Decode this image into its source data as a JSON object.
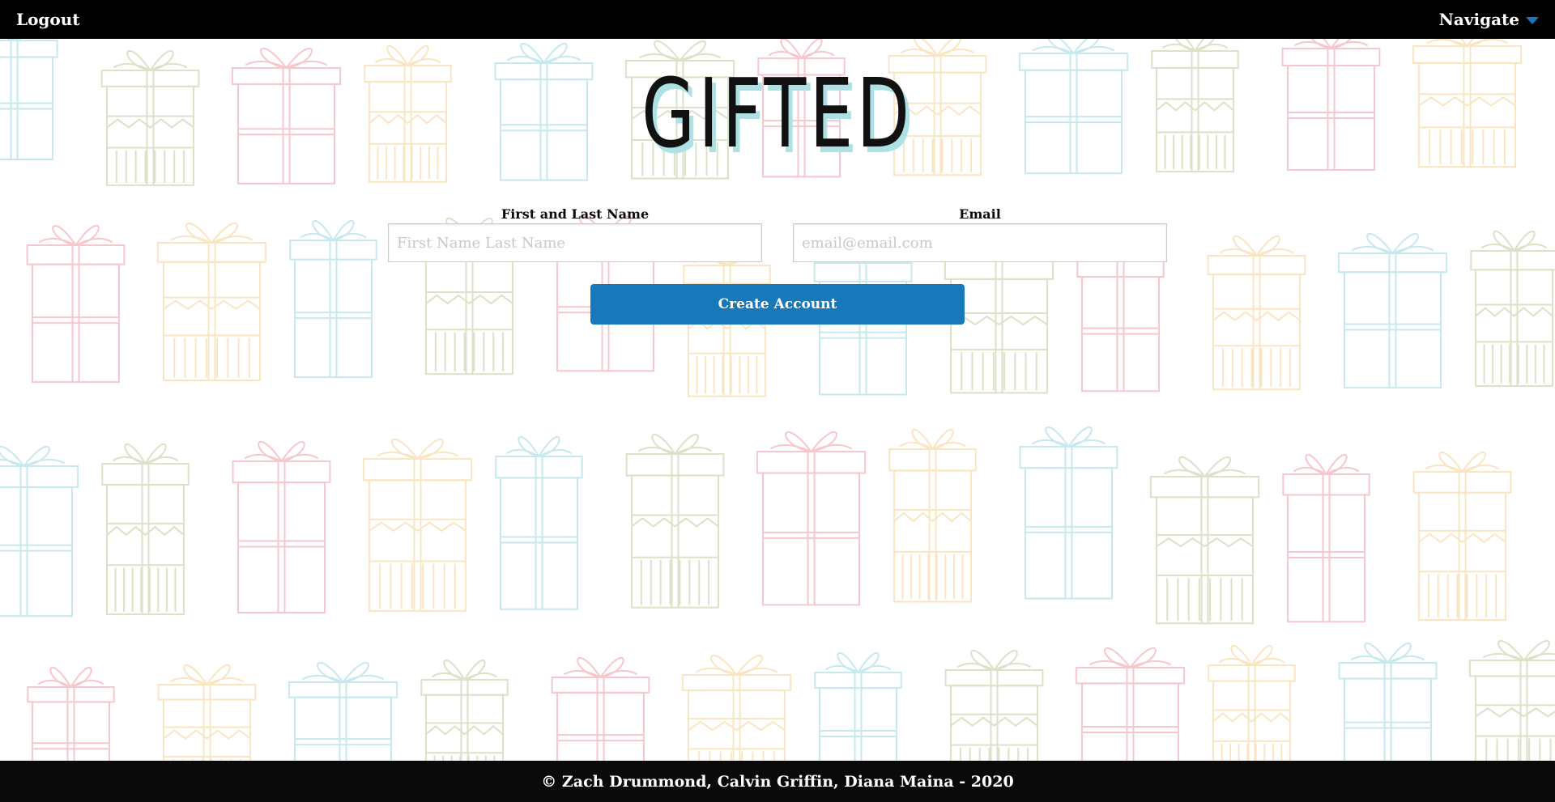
{
  "nav": {
    "logout_label": "Logout",
    "navigate_label": "Navigate"
  },
  "logo": {
    "text": "GIFTED"
  },
  "form": {
    "name_label": "First and Last Name",
    "name_placeholder": "First Name Last Name",
    "email_label": "Email",
    "email_placeholder": "email@email.com",
    "submit_label": "Create Account"
  },
  "footer": {
    "text": "© Zach Drummond, Calvin Griffin, Diana Maina - 2020"
  },
  "colors": {
    "nav_background": "#000000",
    "accent": "#1779ba",
    "logo_shadow": "#aee1e4",
    "gift_pink": "#f2a9b0",
    "gift_blue": "#a9dde3",
    "gift_green": "#c6d3a8",
    "gift_yellow": "#f8d8a0"
  },
  "icons": {
    "navigate_caret": "caret-down-icon",
    "background": "gift-box-icon"
  }
}
